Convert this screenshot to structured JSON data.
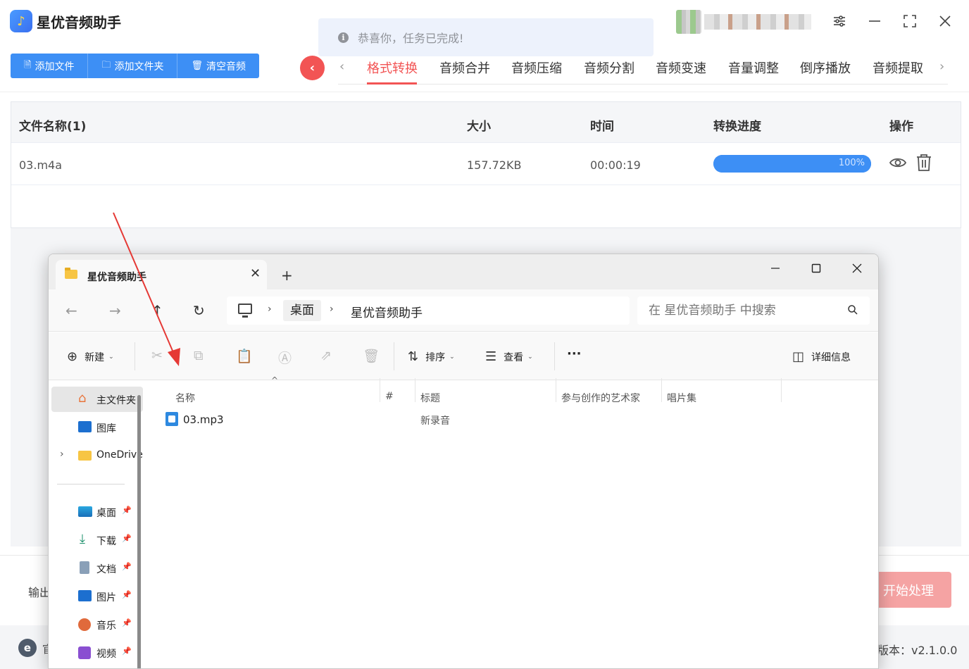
{
  "app": {
    "title": "星优音频助手",
    "toolbar": {
      "add_file": "添加文件",
      "add_folder": "添加文件夹",
      "clear_audio": "清空音频"
    },
    "tabs": [
      "格式转换",
      "音频合并",
      "音频压缩",
      "音频分割",
      "音频变速",
      "音量调整",
      "倒序播放",
      "音频提取"
    ],
    "active_tab": "格式转换",
    "toast": "恭喜你，任务已完成!",
    "table": {
      "headers": {
        "name": "文件名称(1)",
        "size": "大小",
        "time": "时间",
        "progress": "转换进度",
        "action": "操作"
      },
      "rows": [
        {
          "name": "03.m4a",
          "size": "157.72KB",
          "time": "00:00:19",
          "progress_label": "100%",
          "progress": 1.0
        }
      ]
    },
    "output_label": "输出",
    "start_button": "开始处理",
    "footer_text": "官",
    "version": "版本：v2.1.0.0",
    "colors": {
      "accent": "#3d8ff5",
      "active_tab": "#f25454",
      "start_button": "#f5a3a3"
    }
  },
  "explorer": {
    "tab_title": "星优音频助手",
    "breadcrumb": [
      "桌面",
      "星优音频助手"
    ],
    "search_placeholder": "在 星优音频助手 中搜索",
    "commands": {
      "new": "新建",
      "sort": "排序",
      "view": "查看",
      "more": "···",
      "details": "详细信息"
    },
    "sidebar": [
      {
        "label": "主文件夹",
        "icon": "home-icon"
      },
      {
        "label": "图库",
        "icon": "gallery-icon"
      },
      {
        "label": "OneDrive",
        "icon": "folder-icon"
      },
      {
        "label": "桌面",
        "icon": "desktop-icon"
      },
      {
        "label": "下载",
        "icon": "download-icon"
      },
      {
        "label": "文档",
        "icon": "document-icon"
      },
      {
        "label": "图片",
        "icon": "pictures-icon"
      },
      {
        "label": "音乐",
        "icon": "music-icon"
      },
      {
        "label": "视频",
        "icon": "video-icon"
      }
    ],
    "columns": {
      "name": "名称",
      "number": "#",
      "title": "标题",
      "artist": "参与创作的艺术家",
      "album": "唱片集"
    },
    "files": [
      {
        "name": "03.mp3",
        "title": "新录音"
      }
    ]
  }
}
